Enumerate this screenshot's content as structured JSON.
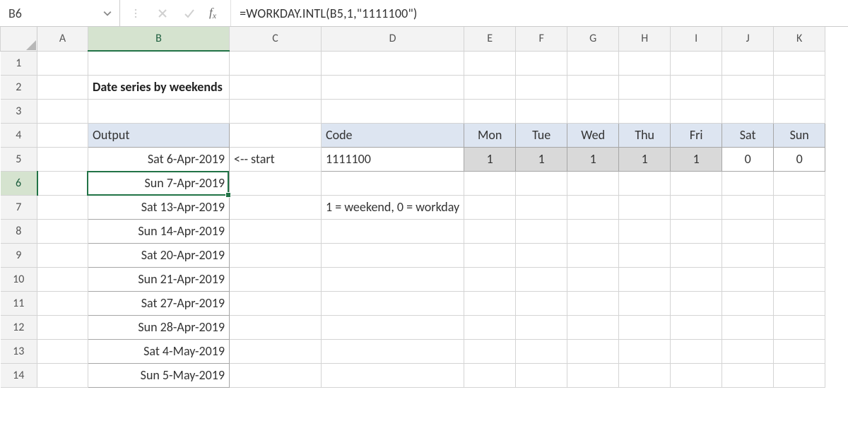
{
  "namebox": {
    "value": "B6"
  },
  "formula_bar": {
    "value": "=WORKDAY.INTL(B5,1,\"1111100\")"
  },
  "col_headers": [
    "A",
    "B",
    "C",
    "D",
    "E",
    "F",
    "G",
    "H",
    "I",
    "J",
    "K"
  ],
  "row_headers": [
    "1",
    "2",
    "3",
    "4",
    "5",
    "6",
    "7",
    "8",
    "9",
    "10",
    "11",
    "12",
    "13",
    "14"
  ],
  "selected": {
    "cell": "B6",
    "row": "6",
    "col": "B"
  },
  "title": "Date series by weekends",
  "output": {
    "header": "Output",
    "values": [
      "Sat 6-Apr-2019",
      "Sun 7-Apr-2019",
      "Sat 13-Apr-2019",
      "Sun 14-Apr-2019",
      "Sat 20-Apr-2019",
      "Sun 21-Apr-2019",
      "Sat 27-Apr-2019",
      "Sun 28-Apr-2019",
      "Sat 4-May-2019",
      "Sun 5-May-2019"
    ]
  },
  "start_note": "<-- start",
  "code_table": {
    "headers": [
      "Code",
      "Mon",
      "Tue",
      "Wed",
      "Thu",
      "Fri",
      "Sat",
      "Sun"
    ],
    "code": "1111100",
    "values": [
      "1",
      "1",
      "1",
      "1",
      "1",
      "0",
      "0"
    ]
  },
  "legend": "1 = weekend, 0 = workday"
}
